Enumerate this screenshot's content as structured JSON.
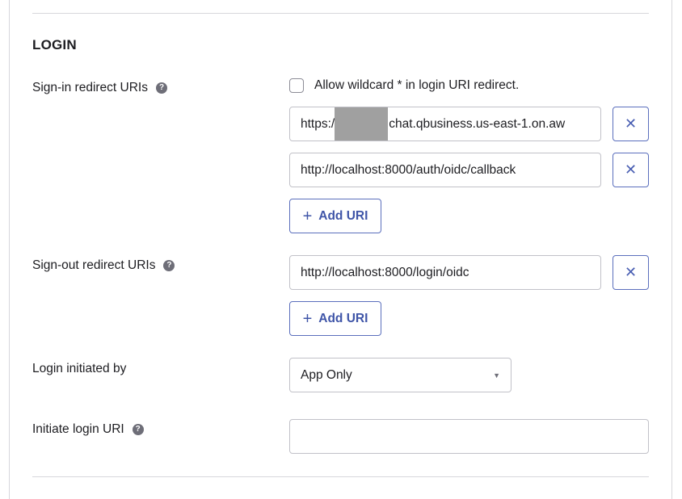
{
  "section": {
    "title": "LOGIN"
  },
  "signin": {
    "label": "Sign-in redirect URIs",
    "wildcard_label": "Allow wildcard * in login URI redirect.",
    "uris": [
      {
        "prefix": "https:/",
        "suffix": "chat.qbusiness.us-east-1.on.aw"
      },
      {
        "value": "http://localhost:8000/auth/oidc/callback"
      }
    ],
    "add_label": "Add URI"
  },
  "signout": {
    "label": "Sign-out redirect URIs",
    "uris": [
      {
        "value": "http://localhost:8000/login/oidc"
      }
    ],
    "add_label": "Add URI"
  },
  "login_initiated": {
    "label": "Login initiated by",
    "selected": "App Only"
  },
  "initiate_uri": {
    "label": "Initiate login URI",
    "value": ""
  },
  "icons": {
    "help": "?",
    "remove": "✕",
    "add": "+",
    "caret": "▼"
  }
}
